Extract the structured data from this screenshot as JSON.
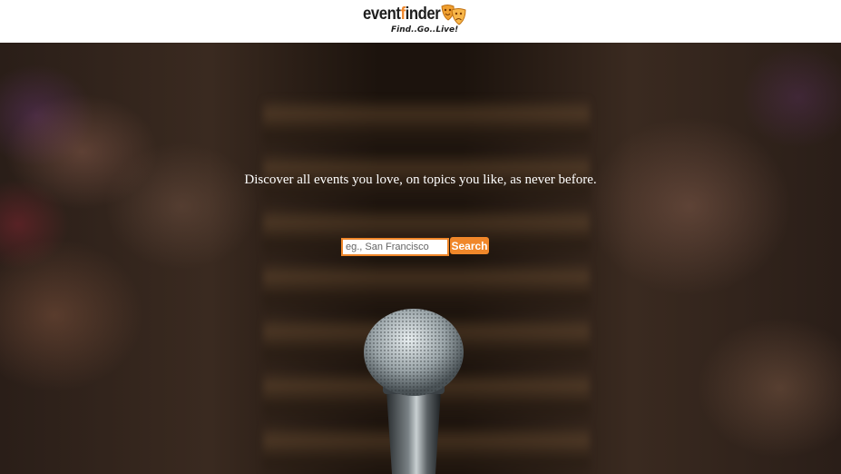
{
  "header": {
    "logo_text_prefix": "event",
    "logo_text_accent": "f",
    "logo_text_suffix": "inder",
    "tagline": "Find..Go..Live!",
    "logo_icon": "theater-masks-icon",
    "accent_color": "#f0872a"
  },
  "hero": {
    "headline": "Discover all events you love, on topics you like, as never before.",
    "background_image": "microphone-stage-audience-photo"
  },
  "search": {
    "placeholder": "eg., San Francisco",
    "value": "",
    "button_label": "Search",
    "button_color": "#f0872a"
  }
}
